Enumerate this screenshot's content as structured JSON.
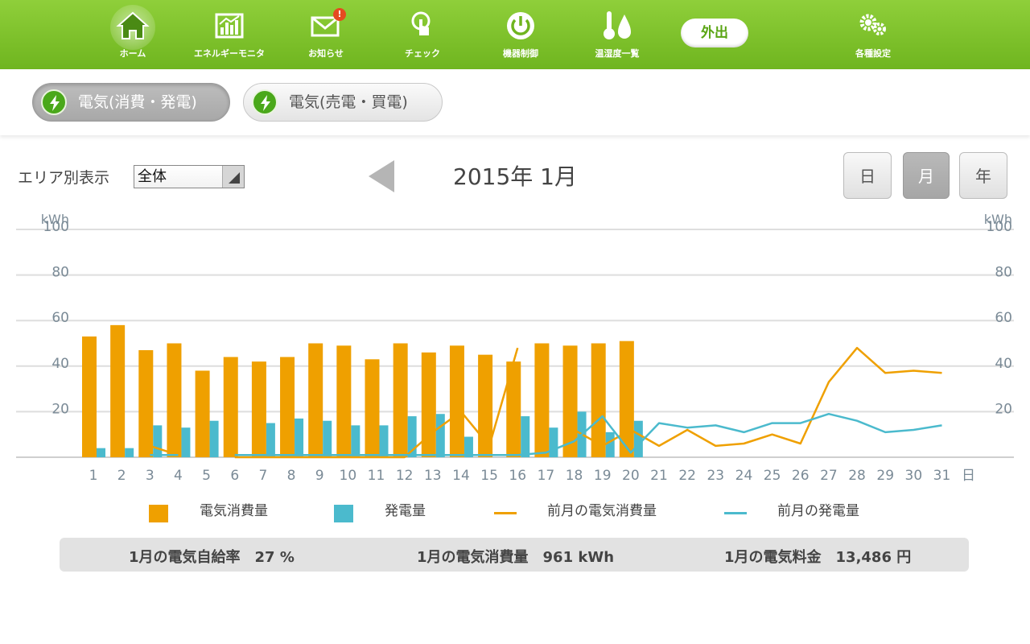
{
  "nav": {
    "items": [
      {
        "label": "ホーム",
        "icon": "home-icon",
        "active": true
      },
      {
        "label": "エネルギーモニタ",
        "icon": "energy-monitor-icon"
      },
      {
        "label": "お知らせ",
        "icon": "mail-icon",
        "badge": "!"
      },
      {
        "label": "チェック",
        "icon": "touch-icon"
      },
      {
        "label": "機器制御",
        "icon": "power-icon"
      },
      {
        "label": "温湿度一覧",
        "icon": "thermo-humidity-icon"
      },
      {
        "label": "各種設定",
        "icon": "gear-icon"
      }
    ],
    "out_label": "外出"
  },
  "tabs": [
    {
      "label": "電気(消費・発電)",
      "active": true
    },
    {
      "label": "電気(売電・買電)",
      "active": false
    }
  ],
  "filter": {
    "label": "エリア別表示",
    "selected": "全体"
  },
  "period": {
    "title": "2015年 1月"
  },
  "period_buttons": [
    {
      "label": "日",
      "active": false
    },
    {
      "label": "月",
      "active": true
    },
    {
      "label": "年",
      "active": false
    }
  ],
  "legend": {
    "consumption": "電気消費量",
    "generation": "発電量",
    "prev_consumption": "前月の電気消費量",
    "prev_generation": "前月の発電量"
  },
  "summary": {
    "self_sufficiency": "1月の電気自給率　27 %",
    "consumption": "1月の電気消費量　961 kWh",
    "cost": "1月の電気料金　13,486 円"
  },
  "colors": {
    "green": "#76bb28",
    "consumption": "#efa000",
    "generation": "#4bbacd",
    "prev_consumption": "#efa000",
    "prev_generation": "#4bbacd"
  },
  "chart_data": {
    "type": "bar",
    "ylabel_left": "kWh",
    "ylabel_right": "kWh",
    "x_unit": "日",
    "ylim": [
      0,
      100
    ],
    "yticks": [
      20,
      40,
      60,
      80,
      100
    ],
    "categories": [
      "1",
      "2",
      "3",
      "4",
      "5",
      "6",
      "7",
      "8",
      "9",
      "10",
      "11",
      "12",
      "13",
      "14",
      "15",
      "16",
      "17",
      "18",
      "19",
      "20",
      "21",
      "22",
      "23",
      "24",
      "25",
      "26",
      "27",
      "28",
      "29",
      "30",
      "31"
    ],
    "series": [
      {
        "name": "電気消費量",
        "kind": "bar",
        "values": [
          53,
          58,
          47,
          50,
          38,
          44,
          42,
          44,
          50,
          49,
          43,
          50,
          46,
          49,
          45,
          42,
          50,
          49,
          50,
          51,
          null,
          null,
          null,
          null,
          null,
          null,
          null,
          null,
          null,
          null,
          null
        ]
      },
      {
        "name": "発電量",
        "kind": "bar",
        "values": [
          4,
          4,
          14,
          13,
          16,
          0,
          15,
          17,
          16,
          14,
          14,
          18,
          19,
          9,
          0,
          18,
          13,
          20,
          11,
          16,
          null,
          null,
          null,
          null,
          null,
          null,
          null,
          null,
          null,
          null,
          null
        ]
      },
      {
        "name": "前月の電気消費量",
        "kind": "line",
        "values": [
          null,
          null,
          5,
          1,
          null,
          0,
          0,
          0,
          0,
          0,
          0,
          0,
          11,
          20,
          5,
          48,
          null,
          12,
          5,
          12,
          5,
          12,
          5,
          6,
          10,
          6,
          33,
          48,
          37,
          38,
          37
        ]
      },
      {
        "name": "前月の発電量",
        "kind": "line",
        "values": [
          null,
          null,
          1,
          1,
          null,
          1,
          1,
          1,
          1,
          1,
          1,
          1,
          1,
          1,
          1,
          1,
          2,
          7,
          18,
          2,
          15,
          13,
          14,
          11,
          15,
          15,
          19,
          16,
          11,
          12,
          14
        ]
      }
    ]
  }
}
